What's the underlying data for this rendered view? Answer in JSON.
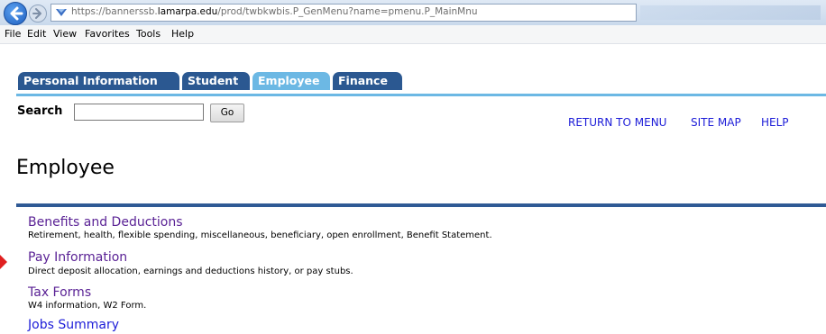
{
  "browser": {
    "url_prefix": "https://bannerssb.",
    "url_host": "lamarpa.edu",
    "url_path": "/prod/twbkwbis.P_GenMenu?name=pmenu.P_MainMnu"
  },
  "menubar": {
    "items": [
      "File",
      "Edit",
      "View",
      "Favorites",
      "Tools",
      "Help"
    ]
  },
  "tabs": [
    {
      "label": "Personal Information"
    },
    {
      "label": "Student"
    },
    {
      "label": "Employee"
    },
    {
      "label": "Finance"
    }
  ],
  "search": {
    "label": "Search",
    "value": "",
    "button": "Go"
  },
  "top_links": [
    "RETURN TO MENU",
    "SITE MAP",
    "HELP"
  ],
  "page_title": "Employee",
  "entries": [
    {
      "title": "Benefits and Deductions",
      "desc": "Retirement, health, flexible spending, miscellaneous, beneficiary, open enrollment, Benefit Statement."
    },
    {
      "title": "Pay Information",
      "desc": "Direct deposit allocation, earnings and deductions history, or pay stubs."
    },
    {
      "title": "Tax Forms",
      "desc": "W4 information, W2 Form."
    },
    {
      "title": "Jobs Summary",
      "desc": ""
    }
  ],
  "colors": {
    "tab_bg": "#2b5891",
    "tab_active_bg": "#6cb8e4",
    "link_visited": "#5a2295",
    "link": "#1c1cd8",
    "divider": "#2f5a95",
    "marker": "#e02020"
  }
}
